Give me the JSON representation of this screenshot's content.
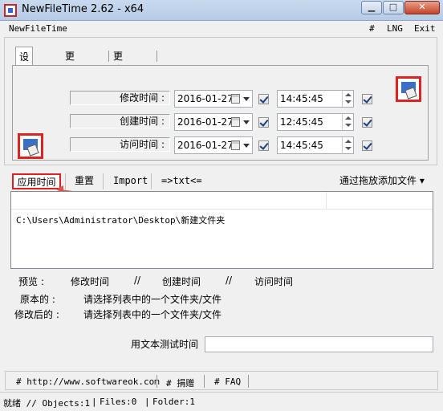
{
  "window": {
    "title": "NewFileTime 2.62 - x64",
    "buttons": {
      "minimize": "▁",
      "maximize": "□",
      "close": "✕"
    }
  },
  "menu": {
    "app_name": "NewFileTime",
    "items": [
      "#",
      "LNG",
      "Exit"
    ]
  },
  "tabs": [
    "设定时间",
    "更早一些",
    "更晚一些"
  ],
  "time_rows": [
    {
      "label": "修改时间 :",
      "date": "2016-01-27",
      "time": "14:45:45"
    },
    {
      "label": "创建时间 :",
      "date": "2016-01-27",
      "time": "12:45:45"
    },
    {
      "label": "访问时间 :",
      "date": "2016-01-27",
      "time": "14:45:45"
    }
  ],
  "actions": {
    "apply": "应用时间",
    "reset": "重置",
    "import": "Import",
    "export": "=>txt<=",
    "drag_add": "通过拖放添加文件 ▾"
  },
  "file_list": {
    "rows": [
      "C:\\Users\\Administrator\\Desktop\\新建文件夹"
    ]
  },
  "preview": {
    "label": "预览 :",
    "modify": "修改时间",
    "sep1": "//",
    "create": "创建时间",
    "sep2": "//",
    "access": "访问时间",
    "original_label": "原本的 :",
    "original_value": "请选择列表中的一个文件夹/文件",
    "modified_label": "修改后的 :",
    "modified_value": "请选择列表中的一个文件夹/文件"
  },
  "text_test": {
    "label": "用文本测试时间",
    "value": ""
  },
  "links": [
    "# http://www.softwareok.com",
    "# 捐赠",
    "# FAQ"
  ],
  "status": {
    "state": "就绪 // Objects:1",
    "files": "Files:0",
    "folder": "Folder:1"
  },
  "colors": {
    "highlight": "#e02020",
    "arrow": "#e05050"
  }
}
